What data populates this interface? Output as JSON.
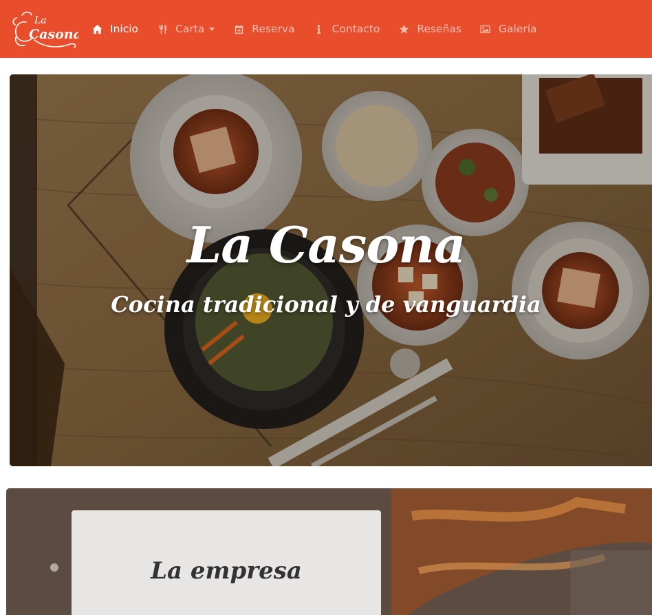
{
  "brand": {
    "logo_text_top": "La",
    "logo_text_main": "Casona",
    "accent_color": "#e94e2c"
  },
  "nav": {
    "items": [
      {
        "label": "Inicio",
        "icon": "home-icon",
        "active": true
      },
      {
        "label": "Carta",
        "icon": "utensils-icon",
        "dropdown": true
      },
      {
        "label": "Reserva",
        "icon": "calendar-plus-icon"
      },
      {
        "label": "Contacto",
        "icon": "info-icon"
      },
      {
        "label": "Reseñas",
        "icon": "star-icon"
      },
      {
        "label": "Galería",
        "icon": "image-icon"
      }
    ]
  },
  "hero": {
    "title": "La Casona",
    "subtitle": "Cocina tradicional y de vanguardia"
  },
  "about": {
    "title": "La empresa"
  }
}
